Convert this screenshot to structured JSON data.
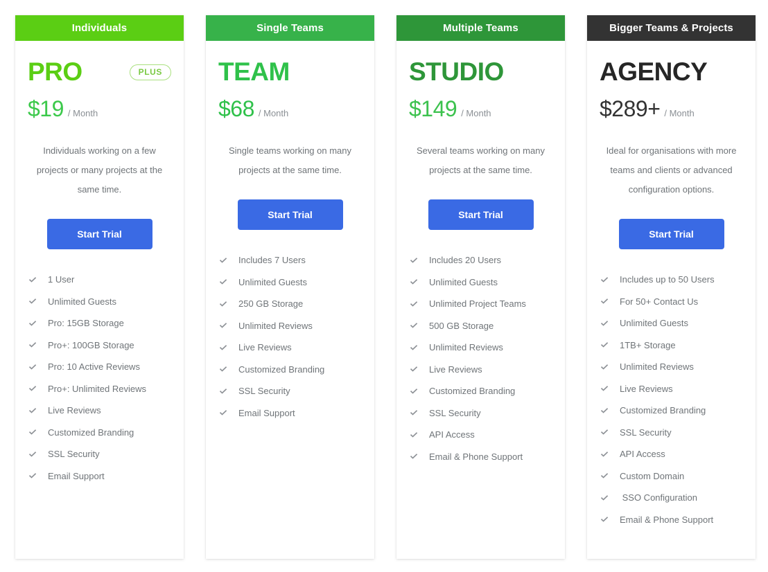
{
  "cards": [
    {
      "header_label": "Individuals",
      "header_bg": "#5BCE14",
      "name": "PRO",
      "name_color": "#5BCE14",
      "badge": "PLUS",
      "has_badge": true,
      "price": "$19",
      "price_color": "#3CC94B",
      "period": "/ Month",
      "description": "Individuals working on a few projects or many projects at the same time.",
      "cta_label": "Start Trial",
      "cta_color": "#3a6ae4",
      "features": [
        "1 User",
        "Unlimited Guests",
        "Pro: 15GB Storage",
        "Pro+: 100GB Storage",
        "Pro: 10 Active Reviews",
        "Pro+: Unlimited Reviews",
        "Live Reviews",
        "Customized Branding",
        "SSL Security",
        "Email Support"
      ]
    },
    {
      "header_label": "Single Teams",
      "header_bg": "#37B24A",
      "name": "TEAM",
      "name_color": "#2FC14A",
      "has_badge": false,
      "badge": "",
      "price": "$68",
      "price_color": "#2FC14A",
      "period": "/ Month",
      "description": "Single teams working on many projects at the same time.",
      "cta_label": "Start Trial",
      "cta_color": "#3a6ae4",
      "features": [
        "Includes 7 Users",
        "Unlimited Guests",
        "250 GB Storage",
        "Unlimited Reviews",
        "Live Reviews",
        "Customized Branding",
        "SSL Security",
        "Email Support"
      ]
    },
    {
      "header_label": "Multiple Teams",
      "header_bg": "#2E9639",
      "name": "STUDIO",
      "name_color": "#2E9639",
      "has_badge": false,
      "badge": "",
      "price": "$149",
      "price_color": "#3CC24E",
      "period": "/ Month",
      "description": "Several teams working on many projects at the same time.",
      "cta_label": "Start Trial",
      "cta_color": "#3a6ae4",
      "features": [
        "Includes 20 Users",
        "Unlimited Guests",
        "Unlimited Project Teams",
        "500 GB Storage",
        "Unlimited Reviews",
        "Live Reviews",
        "Customized Branding",
        "SSL Security",
        "API Access",
        "Email & Phone Support"
      ]
    },
    {
      "header_label": "Bigger Teams & Projects",
      "header_bg": "#333333",
      "name": "AGENCY",
      "name_color": "#262626",
      "has_badge": false,
      "badge": "",
      "price": "$289+",
      "price_color": "#333333",
      "period": "/ Month",
      "description": "Ideal for organisations with more teams and clients or advanced configuration options.",
      "cta_label": "Start Trial",
      "cta_color": "#3a6ae4",
      "features": [
        "Includes up to 50 Users",
        "For 50+ Contact Us",
        "Unlimited Guests",
        "1TB+ Storage",
        "Unlimited Reviews",
        "Live Reviews",
        "Customized Branding",
        "SSL Security",
        "API Access",
        "Custom Domain",
        " SSO Configuration",
        "Email & Phone Support"
      ]
    }
  ],
  "icons": {
    "check": "check-icon"
  }
}
